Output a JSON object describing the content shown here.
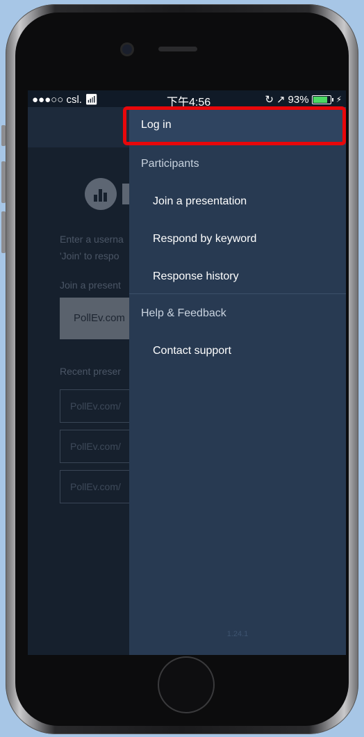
{
  "status_bar": {
    "carrier": "●●●○○ csl.",
    "time": "下午4:56",
    "battery_percent": "93%",
    "battery_level": 0.93
  },
  "background_app": {
    "instruction_line1": "Enter a userna",
    "instruction_line2": "'Join' to respo",
    "join_label": "Join a present",
    "join_field_value": "PollEv.com",
    "recent_label": "Recent preser",
    "recent_items": [
      "PollEv.com/",
      "PollEv.com/",
      "PollEv.com/"
    ]
  },
  "menu": {
    "login": "Log in",
    "participants_header": "Participants",
    "participants_items": [
      "Join a presentation",
      "Respond by keyword",
      "Response history"
    ],
    "help_header": "Help & Feedback",
    "help_items": [
      "Contact support"
    ],
    "version": "1.24.1"
  },
  "colors": {
    "drawer": "#283a52",
    "highlight": "#e8070a",
    "battery": "#4cd964"
  }
}
